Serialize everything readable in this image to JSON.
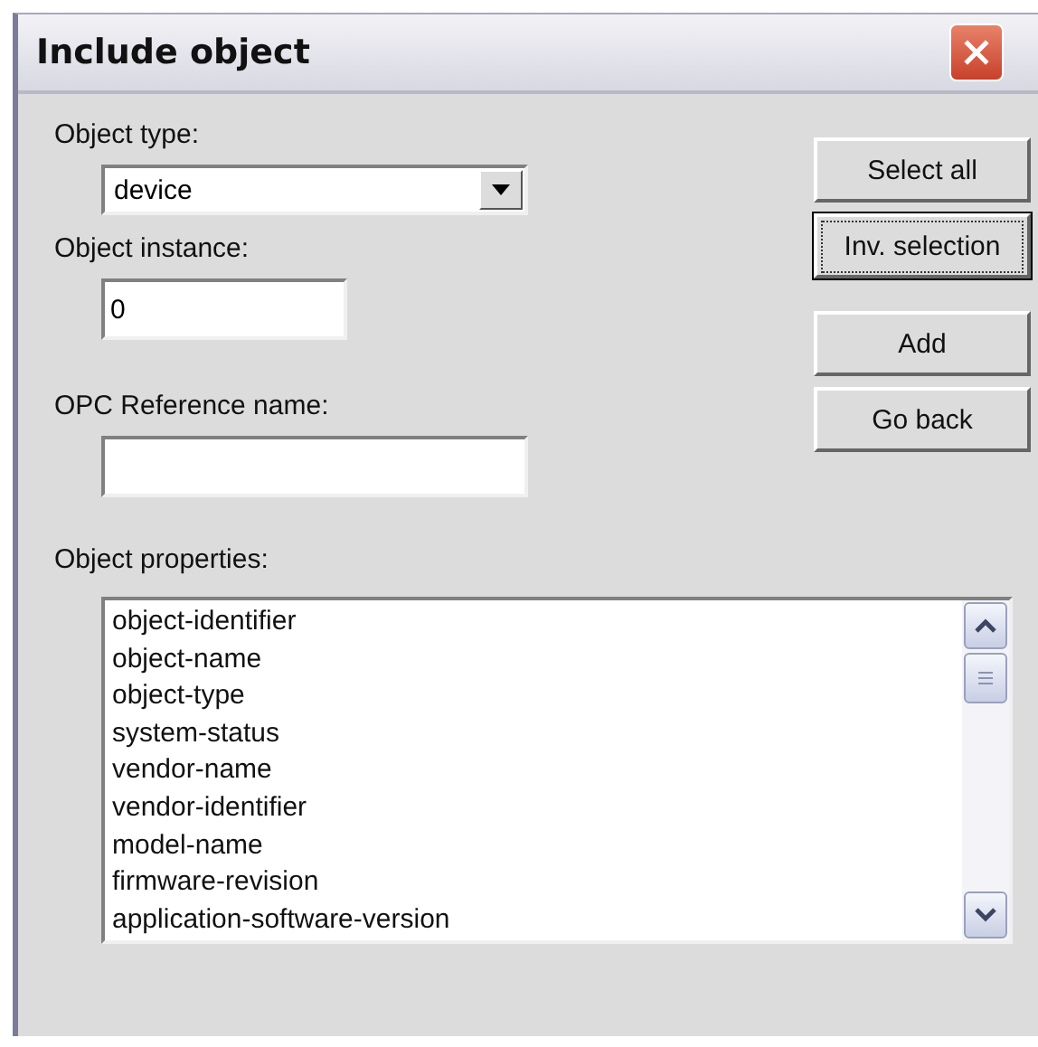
{
  "window": {
    "title": "Include object"
  },
  "object_type": {
    "label": "Object type:",
    "value": "device"
  },
  "object_instance": {
    "label": "Object instance:",
    "value": "0"
  },
  "opc_reference_name": {
    "label": "OPC Reference name:"
  },
  "object_properties": {
    "label": "Object properties:",
    "items": [
      {
        "text": "object-identifier"
      },
      {
        "text": "object-name"
      },
      {
        "text": "object-type"
      },
      {
        "text": "system-status"
      },
      {
        "text": "vendor-name"
      },
      {
        "text": "vendor-identifier"
      },
      {
        "text": "model-name"
      },
      {
        "text": "firmware-revision"
      },
      {
        "text": "application-software-version"
      }
    ]
  },
  "top_buttons": [
    {
      "label": "Select all",
      "focused": false
    },
    {
      "label": "Inv. selection",
      "focused": true
    }
  ],
  "bottom_buttons": [
    {
      "label": "Add",
      "focused": false
    },
    {
      "label": "Go back",
      "focused": false
    }
  ]
}
